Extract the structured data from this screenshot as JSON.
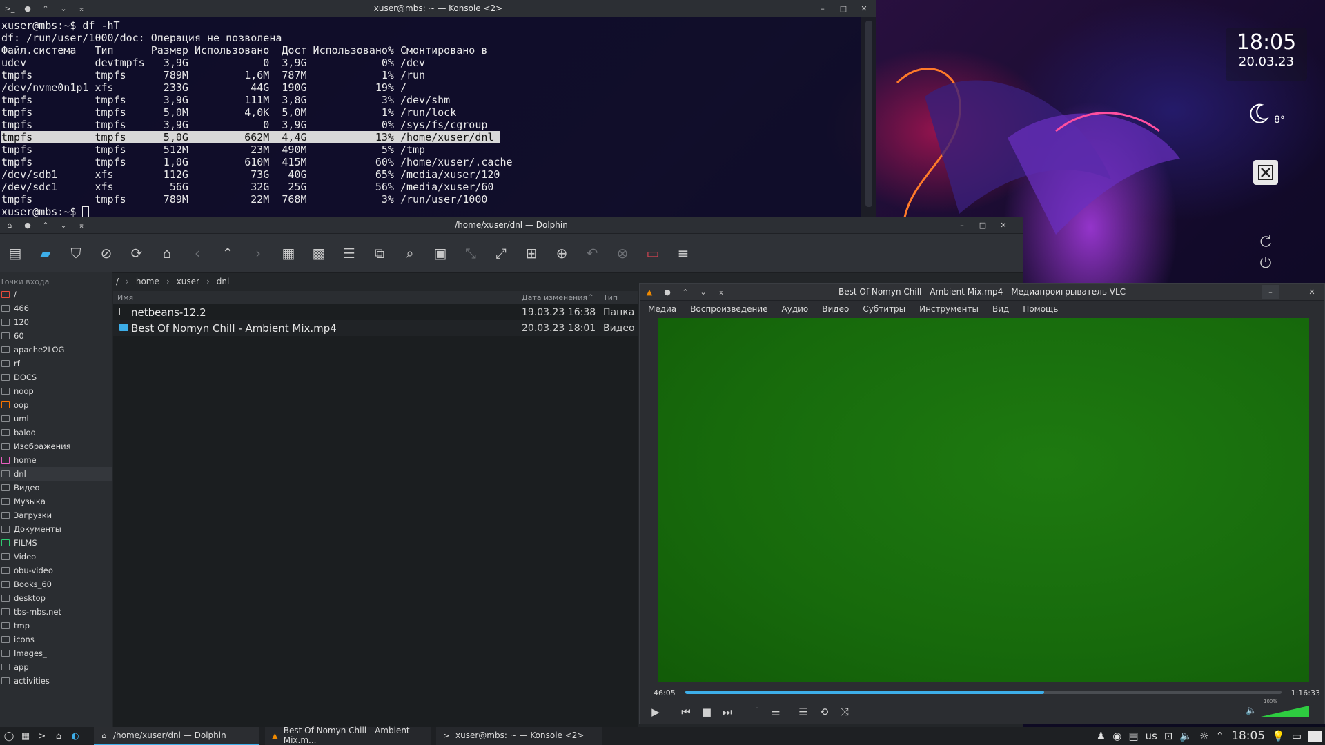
{
  "desktop": {
    "clock_time": "18:05",
    "clock_date": "20.03.23",
    "weather_temp": "8°"
  },
  "konsole": {
    "title": "xuser@mbs: ~ — Konsole <2>",
    "lines": [
      "xuser@mbs:~$ df -hT",
      "df: /run/user/1000/doc: Операция не позволена",
      "Файл.система   Тип      Размер Использовано  Дост Использовано% Смонтировано в",
      "udev           devtmpfs   3,9G            0  3,9G            0% /dev",
      "tmpfs          tmpfs      789M         1,6M  787M            1% /run",
      "/dev/nvme0n1p1 xfs        233G          44G  190G           19% /",
      "tmpfs          tmpfs      3,9G         111M  3,8G            3% /dev/shm",
      "tmpfs          tmpfs      5,0M         4,0K  5,0M            1% /run/lock",
      "tmpfs          tmpfs      3,9G            0  3,9G            0% /sys/fs/cgroup",
      "tmpfs          tmpfs      5,0G         662M  4,4G           13% /home/xuser/dnl ",
      "tmpfs          tmpfs      512M          23M  490M            5% /tmp",
      "tmpfs          tmpfs      1,0G         610M  415M           60% /home/xuser/.cache",
      "/dev/sdb1      xfs        112G          73G   40G           65% /media/xuser/120",
      "/dev/sdc1      xfs         56G          32G   25G           56% /media/xuser/60",
      "tmpfs          tmpfs      789M          22M  768M            3% /run/user/1000",
      "xuser@mbs:~$ "
    ],
    "highlight_line": 9
  },
  "dolphin": {
    "title": "/home/xuser/dnl — Dolphin",
    "places_header": "Точки входа",
    "places": [
      {
        "label": "/",
        "color": "red"
      },
      {
        "label": "466",
        "color": ""
      },
      {
        "label": "120",
        "color": ""
      },
      {
        "label": "60",
        "color": ""
      },
      {
        "label": "apache2LOG",
        "color": ""
      },
      {
        "label": "rf",
        "color": ""
      },
      {
        "label": "DOCS",
        "color": ""
      },
      {
        "label": "noop",
        "color": ""
      },
      {
        "label": "oop",
        "color": "orange"
      },
      {
        "label": "uml",
        "color": ""
      },
      {
        "label": "baloo",
        "color": ""
      },
      {
        "label": "Изображения",
        "color": ""
      },
      {
        "label": "home",
        "color": "pink"
      },
      {
        "label": "dnl",
        "color": ""
      },
      {
        "label": "Видео",
        "color": ""
      },
      {
        "label": "Музыка",
        "color": ""
      },
      {
        "label": "Загрузки",
        "color": ""
      },
      {
        "label": "Документы",
        "color": ""
      },
      {
        "label": "FILMS",
        "color": "green"
      },
      {
        "label": "Video",
        "color": ""
      },
      {
        "label": "obu-video",
        "color": ""
      },
      {
        "label": "Books_60",
        "color": ""
      },
      {
        "label": "desktop",
        "color": ""
      },
      {
        "label": "tbs-mbs.net",
        "color": ""
      },
      {
        "label": "tmp",
        "color": ""
      },
      {
        "label": "icons",
        "color": ""
      },
      {
        "label": "Images_",
        "color": ""
      },
      {
        "label": "app",
        "color": ""
      },
      {
        "label": "activities",
        "color": ""
      }
    ],
    "active_place": 13,
    "breadcrumb": [
      "/",
      "home",
      "xuser",
      "dnl"
    ],
    "columns": {
      "name": "Имя",
      "date": "Дата изменения",
      "type": "Тип"
    },
    "files": [
      {
        "name": "netbeans-12.2",
        "date": "19.03.23 16:38",
        "type": "Папка",
        "kind": "folder"
      },
      {
        "name": "Best Of Nomyn Chill - Ambient Mix.mp4",
        "date": "20.03.23 18:01",
        "type": "Видео",
        "kind": "video"
      }
    ]
  },
  "vlc": {
    "title": "Best Of Nomyn Chill - Ambient Mix.mp4 - Медиапроигрыватель VLC",
    "menu": [
      "Медиа",
      "Воспроизведение",
      "Аудио",
      "Видео",
      "Субтитры",
      "Инструменты",
      "Вид",
      "Помощь"
    ],
    "time_elapsed": "46:05",
    "time_total": "1:16:33",
    "progress": 0.602,
    "volume_label": "100%",
    "volume": 1.0
  },
  "taskbar": {
    "tasks": [
      {
        "label": "/home/xuser/dnl — Dolphin"
      },
      {
        "label": "Best Of Nomyn Chill - Ambient Mix.m..."
      },
      {
        "label": "xuser@mbs: ~ — Konsole <2>"
      }
    ],
    "keyboard_layout": "us",
    "clock": "18:05"
  },
  "colors": {
    "accent": "#3daee9",
    "video_green": "#176a0c",
    "terminal_bg": "#0e0e28"
  }
}
